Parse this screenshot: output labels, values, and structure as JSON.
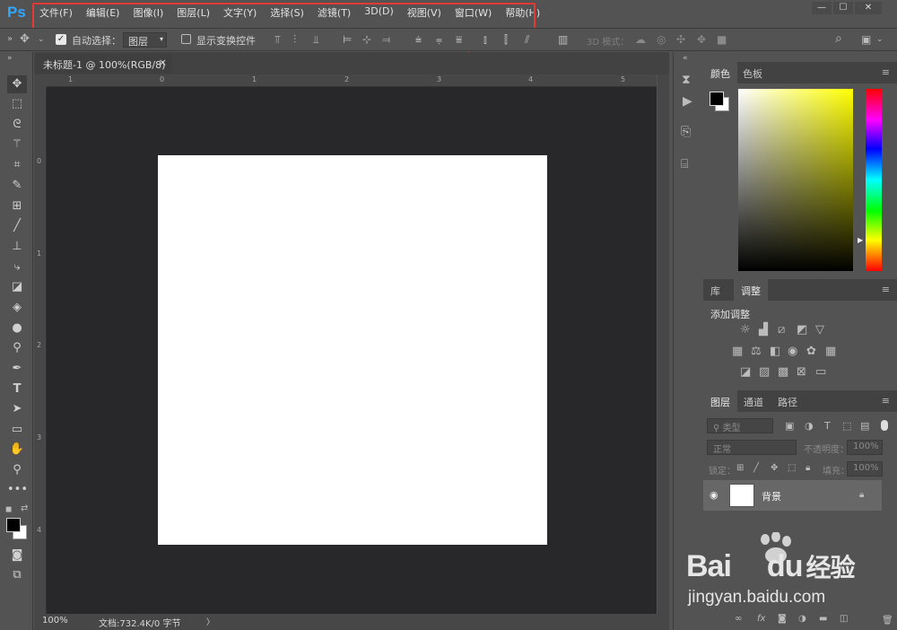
{
  "app": {
    "logo": "Ps",
    "window_controls": [
      "—",
      "☐",
      "✕"
    ]
  },
  "menu": [
    "文件(F)",
    "编辑(E)",
    "图像(I)",
    "图层(L)",
    "文字(Y)",
    "选择(S)",
    "滤镜(T)",
    "3D(D)",
    "视图(V)",
    "窗口(W)",
    "帮助(H)"
  ],
  "options": {
    "auto_select_label": "自动选择：",
    "auto_select_checked": true,
    "auto_select_value": "图层",
    "show_transform_label": "显示变换控件",
    "mode_3d_label": "3D 模式："
  },
  "document": {
    "tab_title": "未标题-1 @ 100%(RGB/8)",
    "close": "×"
  },
  "rulers": {
    "h_ticks": [
      "1",
      "0",
      "1",
      "2",
      "3",
      "4",
      "5"
    ],
    "v_ticks": [
      "0",
      "1",
      "2",
      "3",
      "4"
    ]
  },
  "status": {
    "zoom": "100%",
    "doc_info": "文档:732.4K/0 字节",
    "arrow": "〉"
  },
  "panels": {
    "color": {
      "tabs": [
        "颜色",
        "色板"
      ]
    },
    "adjust": {
      "tabs": [
        "库",
        "调整"
      ],
      "title": "添加调整"
    },
    "layers": {
      "tabs": [
        "图层",
        "通道",
        "路径"
      ],
      "filter_placeholder": "类型",
      "blend_mode": "正常",
      "opacity_label": "不透明度：",
      "opacity_value": "100%",
      "lock_label": "锁定：",
      "fill_label": "填充：",
      "fill_value": "100%",
      "layer_name": "背景"
    }
  },
  "watermark": {
    "brand_a": "Bai",
    "brand_b": "du",
    "brand_c": "经验",
    "url": "jingyan.baidu.com"
  },
  "annotation": {
    "color": "#e53935"
  }
}
